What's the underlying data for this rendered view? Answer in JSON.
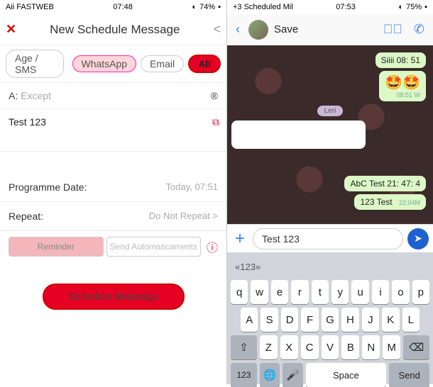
{
  "left": {
    "status": {
      "carrier": "Aii FASTWEB",
      "time": "07:48",
      "battery": "74%"
    },
    "nav": {
      "title": "New Schedule Message",
      "back": "<"
    },
    "tabs": {
      "sms": "Age / SMS",
      "whatsapp": "WhatsApp",
      "email": "Email",
      "all": "All"
    },
    "to": {
      "label": "A:",
      "value": "Except"
    },
    "message": "Test 123",
    "date": {
      "label": "Programme Date:",
      "value": "Today, 07:51"
    },
    "repeat": {
      "label": "Repeat:",
      "value": "Do Not Repeat >"
    },
    "mode": {
      "reminder": "Reminder",
      "auto": "Send Automaticaments"
    },
    "schedule": "Schedule Message"
  },
  "right": {
    "status": {
      "title": "+3 Scheduled Mil",
      "time": "07:53",
      "battery": "75%"
    },
    "nav": {
      "name": "Save"
    },
    "chat": {
      "msg1": "Siiii 08: 51",
      "msg1time": "08:51 W",
      "emoji": "🤩🤩",
      "datechip": "Leri",
      "msg2": "AbC Test 21: 47: 4",
      "msg3": "123 Test",
      "msg3time": "22:04M"
    },
    "input": "Test 123",
    "kbd": {
      "suggest": "«123»",
      "r1": [
        "q",
        "w",
        "e",
        "r",
        "t",
        "y",
        "u",
        "i",
        "o",
        "p"
      ],
      "r2": [
        "A",
        "S",
        "D",
        "F",
        "G",
        "H",
        "J",
        "K",
        "L"
      ],
      "r3": [
        "Z",
        "X",
        "C",
        "V",
        "B",
        "N",
        "M"
      ],
      "num": "123",
      "space": "Space",
      "send": "Send"
    }
  }
}
